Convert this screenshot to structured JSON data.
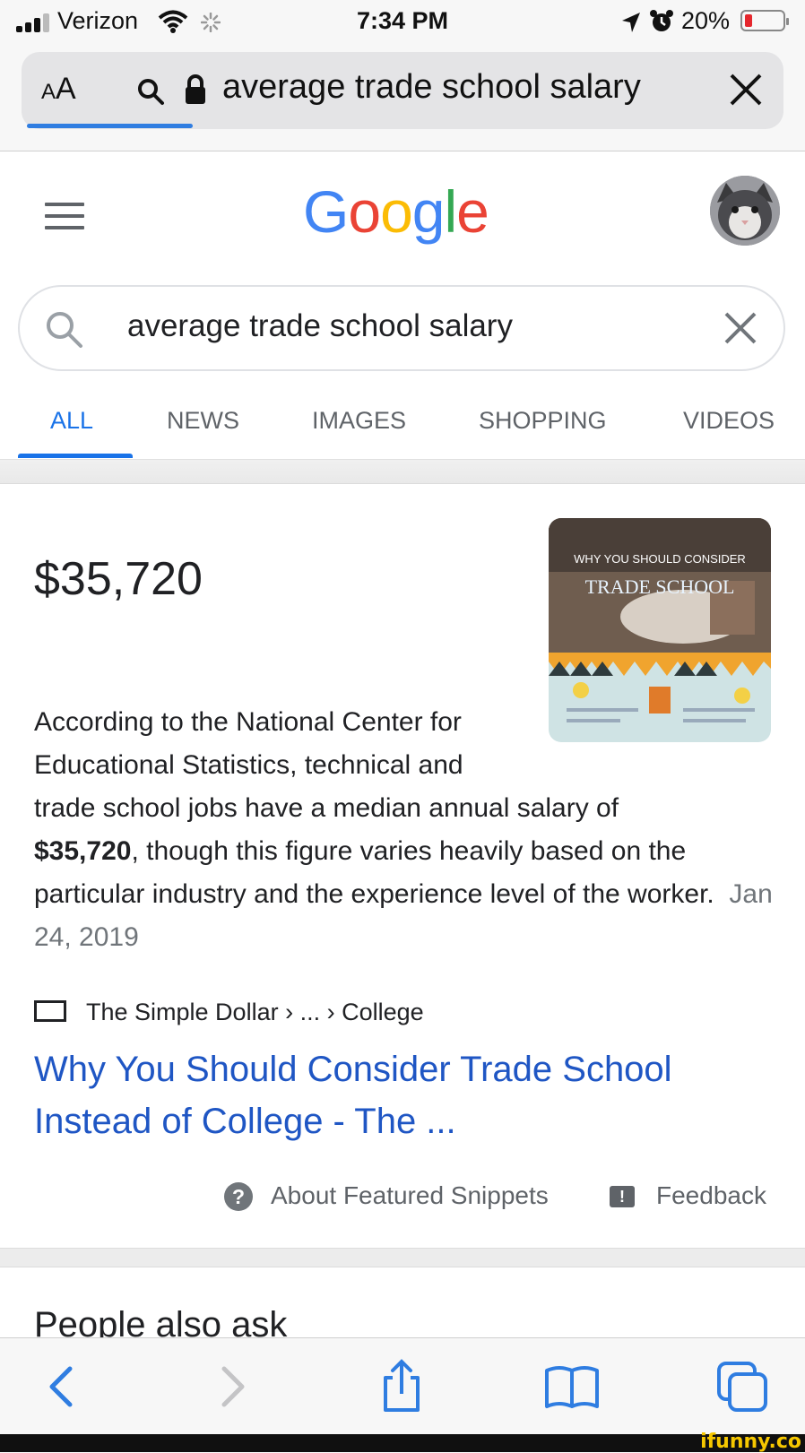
{
  "status_bar": {
    "carrier": "Verizon",
    "time": "7:34 PM",
    "battery_percent": "20%",
    "battery_level": 0.2
  },
  "browser": {
    "text_size_label": "AA",
    "url": "average trade school salary",
    "load_progress": 0.22
  },
  "google": {
    "logo_letters": [
      "G",
      "o",
      "o",
      "g",
      "l",
      "e"
    ],
    "logo_colors": [
      "#4285F4",
      "#EA4335",
      "#FBBC05",
      "#4285F4",
      "#34A853",
      "#EA4335"
    ],
    "search_query": "average trade school salary",
    "tabs": [
      "ALL",
      "NEWS",
      "IMAGES",
      "SHOPPING",
      "VIDEOS"
    ],
    "active_tab": "ALL"
  },
  "featured_snippet": {
    "answer": "$35,720",
    "image_overlay_title": "WHY YOU SHOULD CONSIDER",
    "image_overlay_subtitle": "TRADE SCHOOL",
    "text_lines": [
      "According to the National Center for",
      "Educational Statistics, technical and",
      "trade school jobs have a median annual salary of"
    ],
    "bold_value": "$35,720",
    "text_after_bold": ", though this figure varies heavily based on the particular industry and the experience level of the worker.",
    "date": "Jan 24, 2019",
    "source_breadcrumb": "The Simple Dollar › ... › College",
    "result_title": "Why You Should Consider Trade School Instead of College - The ...",
    "about_label": "About Featured Snippets",
    "feedback_label": "Feedback"
  },
  "people_also_ask": {
    "heading": "People also ask"
  },
  "watermark": "ifunny.co",
  "colors": {
    "link_blue": "#1f56c4",
    "tab_active": "#1a73e8",
    "safari_blue": "#2f7de1"
  }
}
